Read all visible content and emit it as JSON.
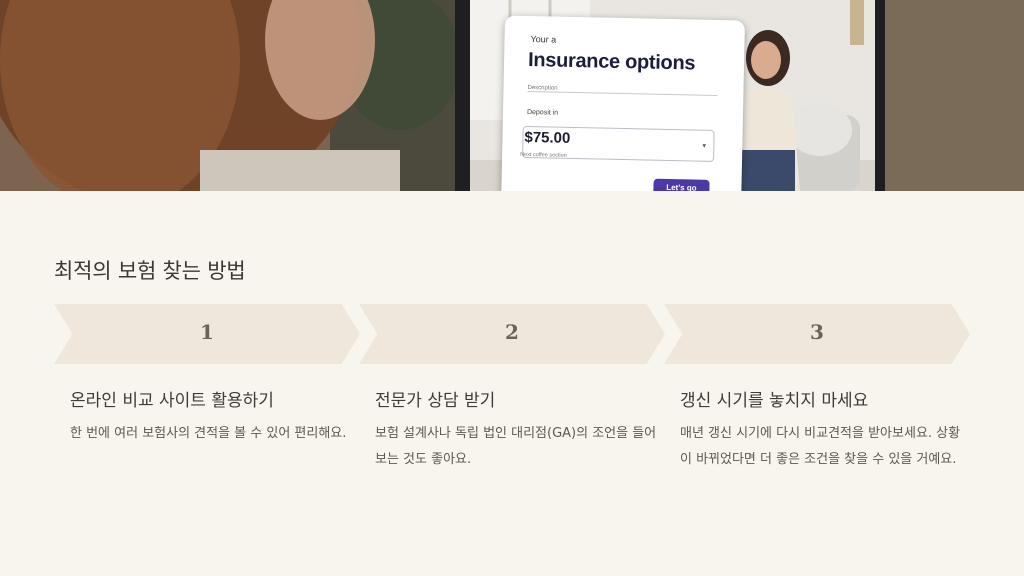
{
  "hero": {
    "screen": {
      "eyebrow": "Your a",
      "title": "Insurance options",
      "subtext": "Description",
      "field_label": "Deposit in",
      "price": "$75.00",
      "note": "Next coffee section",
      "button_label": "Let's go"
    }
  },
  "section": {
    "title": "최적의 보험 찾는 방법"
  },
  "steps": [
    {
      "number": "1",
      "title": "온라인 비교 사이트 활용하기",
      "description": "한 번에 여러 보험사의 견적을 볼 수 있어 편리해요."
    },
    {
      "number": "2",
      "title": "전문가 상담 받기",
      "description": "보험 설계사나 독립 법인 대리점(GA)의 조언을 들어보는 것도 좋아요."
    },
    {
      "number": "3",
      "title": "갱신 시기를 놓치지 마세요",
      "description": "매년 갱신 시기에 다시 비교견적을 받아보세요. 상황이 바뀌었다면 더 좋은 조건을 찾을 수 있을 거예요."
    }
  ]
}
